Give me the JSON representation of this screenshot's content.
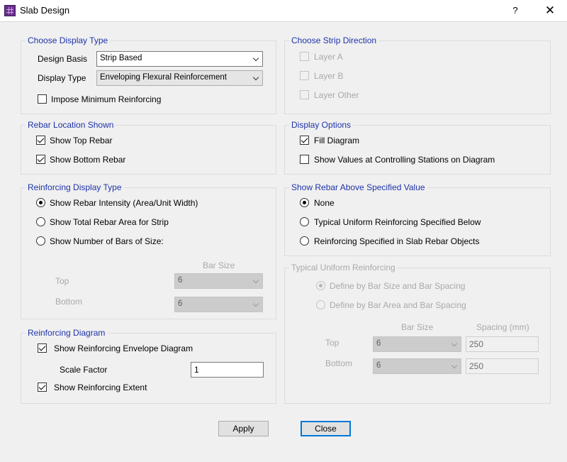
{
  "window": {
    "title": "Slab Design",
    "help": "?",
    "close": "✕"
  },
  "display_type": {
    "title": "Choose Display Type",
    "design_basis_label": "Design Basis",
    "design_basis_value": "Strip Based",
    "display_type_label": "Display Type",
    "display_type_value": "Enveloping Flexural Reinforcement",
    "impose_min_label": "Impose Minimum Reinforcing",
    "impose_min_checked": false
  },
  "strip_direction": {
    "title": "Choose Strip Direction",
    "layer_a": "Layer A",
    "layer_b": "Layer B",
    "layer_other": "Layer Other"
  },
  "rebar_location": {
    "title": "Rebar Location Shown",
    "top": "Show Top Rebar",
    "bottom": "Show Bottom Rebar"
  },
  "display_options": {
    "title": "Display Options",
    "fill": "Fill Diagram",
    "values": "Show Values at Controlling Stations on Diagram"
  },
  "reinf_display_type": {
    "title": "Reinforcing Display Type",
    "opt1": "Show Rebar Intensity (Area/Unit Width)",
    "opt2": "Show Total Rebar Area for Strip",
    "opt3": "Show Number of Bars of Size:",
    "bar_size_header": "Bar Size",
    "top_label": "Top",
    "top_value": "6",
    "bottom_label": "Bottom",
    "bottom_value": "6"
  },
  "show_above": {
    "title": "Show Rebar Above Specified Value",
    "none": "None",
    "typical": "Typical Uniform Reinforcing Specified Below",
    "slab_objects": "Reinforcing Specified in Slab Rebar Objects"
  },
  "typical_uniform": {
    "title": "Typical Uniform Reinforcing",
    "opt1": "Define by Bar Size and Bar Spacing",
    "opt2": "Define by Bar Area and Bar Spacing",
    "bar_size_header": "Bar Size",
    "spacing_header": "Spacing  (mm)",
    "top_label": "Top",
    "top_size": "6",
    "top_spacing": "250",
    "bottom_label": "Bottom",
    "bottom_size": "6",
    "bottom_spacing": "250"
  },
  "reinf_diagram": {
    "title": "Reinforcing Diagram",
    "envelope": "Show Reinforcing Envelope Diagram",
    "scale_label": "Scale Factor",
    "scale_value": "1",
    "extent": "Show Reinforcing Extent"
  },
  "buttons": {
    "apply": "Apply",
    "close": "Close"
  }
}
